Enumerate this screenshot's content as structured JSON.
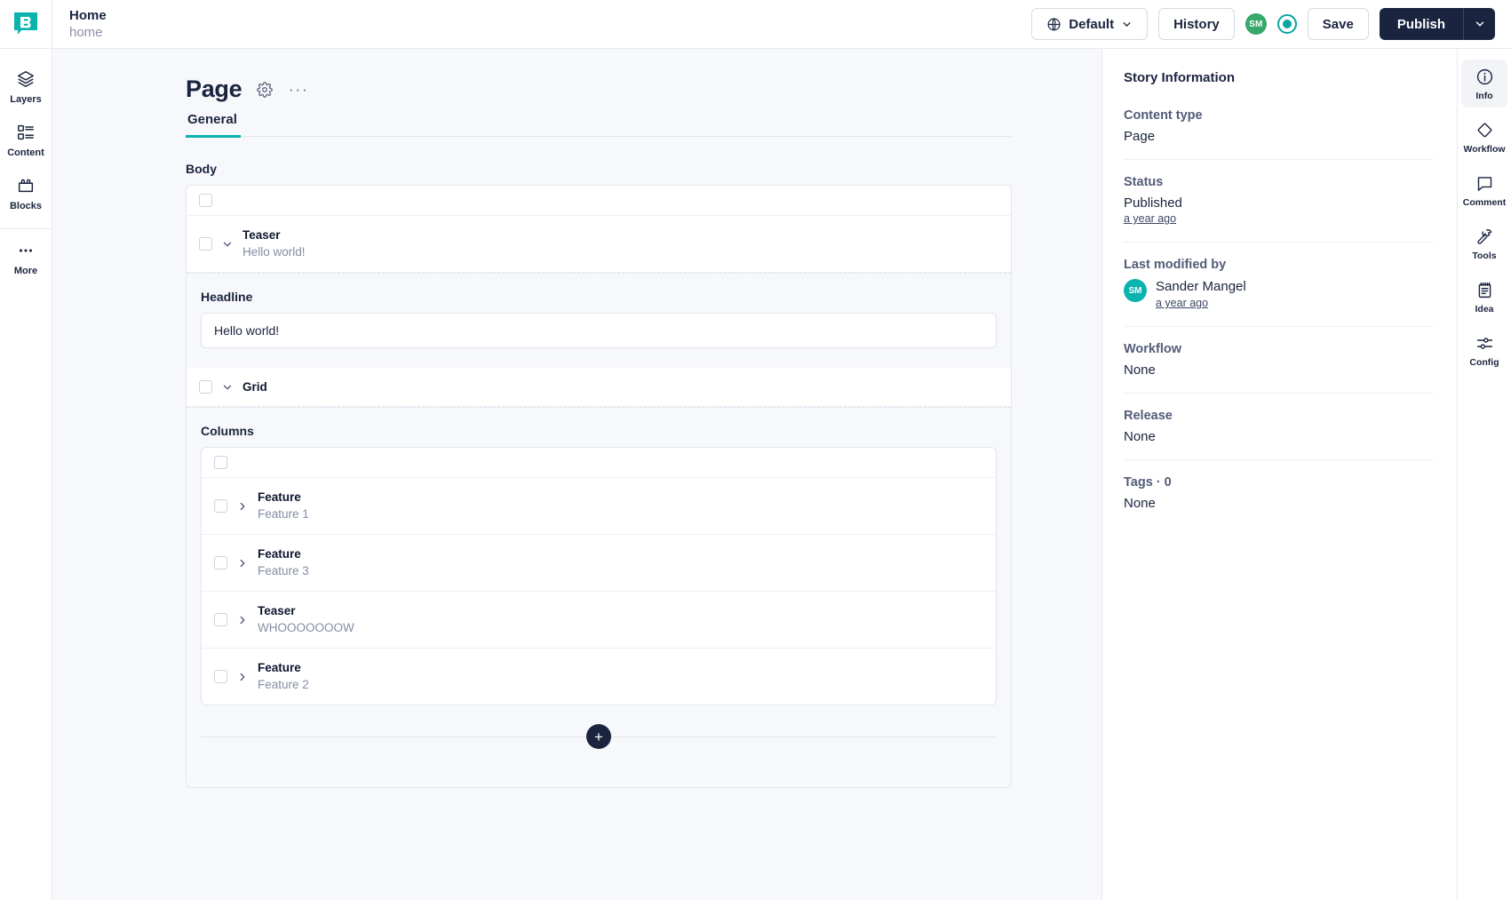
{
  "app": {
    "logo_letter": "B",
    "brand_color": "#0ab3ae",
    "dark_color": "#1b243f"
  },
  "breadcrumb": {
    "title": "Home",
    "slug": "home"
  },
  "topbar": {
    "space_label": "Default",
    "history_label": "History",
    "avatar_initials": "SM",
    "avatar_color": "#35a86a",
    "save_label": "Save",
    "publish_label": "Publish",
    "icons": {
      "globe": "globe-icon",
      "chevron": "chevron-down-icon",
      "record": "record-dot-icon"
    }
  },
  "left_rail": {
    "items": [
      {
        "label": "Layers",
        "icon": "layers-icon"
      },
      {
        "label": "Content",
        "icon": "content-list-icon"
      },
      {
        "label": "Blocks",
        "icon": "blocks-icon"
      },
      {
        "label": "More",
        "icon": "ellipsis-icon"
      }
    ]
  },
  "editor": {
    "title": "Page",
    "settings_icon": "gear-icon",
    "more_icon": "ellipsis-icon",
    "tabs": [
      {
        "label": "General",
        "active": true
      }
    ],
    "body_label": "Body",
    "body_bloks": [
      {
        "name": "Teaser",
        "desc": "Hello world!",
        "expanded": true
      },
      {
        "name": "Grid",
        "desc": "",
        "expanded": true
      }
    ],
    "headline_label": "Headline",
    "headline_value": "Hello world!",
    "headline_placeholder": "",
    "columns_label": "Columns",
    "columns_bloks": [
      {
        "name": "Feature",
        "desc": "Feature 1"
      },
      {
        "name": "Feature",
        "desc": "Feature 3"
      },
      {
        "name": "Teaser",
        "desc": "WHOOOOOOOW"
      },
      {
        "name": "Feature",
        "desc": "Feature 2"
      }
    ],
    "add_label": "+"
  },
  "info_panel": {
    "title": "Story Information",
    "content_type_key": "Content type",
    "content_type_value": "Page",
    "status_key": "Status",
    "status_value": "Published",
    "status_time": "a year ago",
    "modified_key": "Last modified by",
    "modified_initials": "SM",
    "modified_name": "Sander Mangel",
    "modified_time": "a year ago",
    "workflow_key": "Workflow",
    "workflow_value": "None",
    "release_key": "Release",
    "release_value": "None",
    "tags_key": "Tags · 0",
    "tags_value": "None"
  },
  "right_rail": {
    "items": [
      {
        "label": "Info",
        "icon": "info-circle-icon",
        "active": true
      },
      {
        "label": "Workflow",
        "icon": "diamond-icon",
        "active": false
      },
      {
        "label": "Comment",
        "icon": "comment-bubble-icon",
        "active": false
      },
      {
        "label": "Tools",
        "icon": "hammer-icon",
        "active": false
      },
      {
        "label": "Idea",
        "icon": "notepad-icon",
        "active": false
      },
      {
        "label": "Config",
        "icon": "sliders-icon",
        "active": false
      }
    ]
  }
}
